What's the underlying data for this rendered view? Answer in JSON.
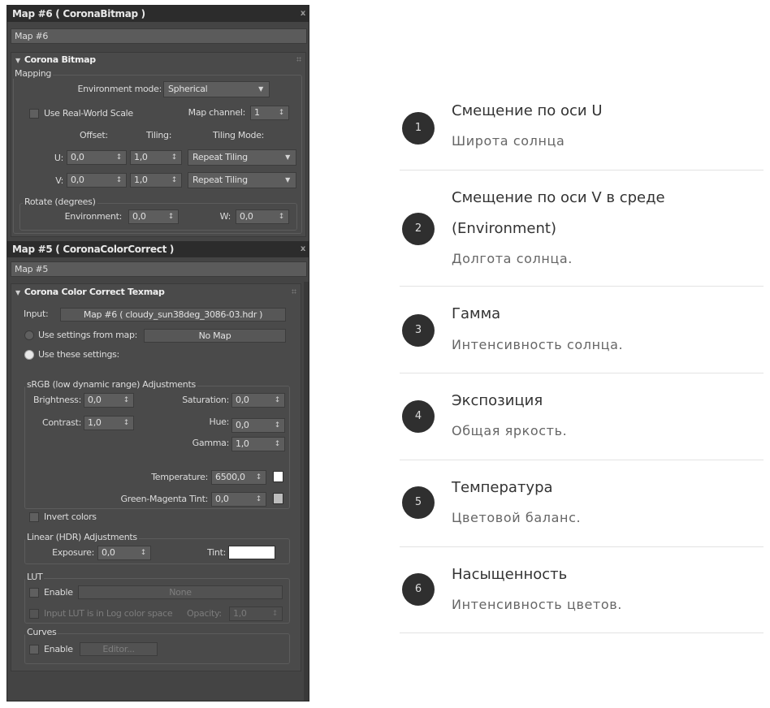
{
  "map6": {
    "title": "Map #6  ( CoronaBitmap )",
    "close": "x",
    "name": "Map #6",
    "rollout_title": "Corona Bitmap",
    "mapping_label": "Mapping",
    "env_mode_label": "Environment mode:",
    "env_mode_value": "Spherical",
    "real_world_scale": "Use Real-World Scale",
    "map_channel_label": "Map channel:",
    "map_channel_value": "1",
    "offset_header": "Offset:",
    "tiling_header": "Tiling:",
    "tiling_mode_header": "Tiling Mode:",
    "u_label": "U:",
    "v_label": "V:",
    "u_offset": "0,0",
    "u_tiling": "1,0",
    "u_mode": "Repeat Tiling",
    "v_offset": "0,0",
    "v_tiling": "1,0",
    "v_mode": "Repeat Tiling",
    "rotate_label": "Rotate (degrees)",
    "environment_label": "Environment:",
    "environment_value": "0,0",
    "w_label": "W:",
    "w_value": "0,0"
  },
  "map5": {
    "title": "Map #5  ( CoronaColorCorrect )",
    "close": "x",
    "name": "Map #5",
    "rollout_title": "Corona Color Correct Texmap",
    "input_label": "Input:",
    "input_value": "Map #6 ( cloudy_sun38deg_3086-03.hdr )",
    "use_settings_from_map": "Use settings from map:",
    "no_map": "No Map",
    "use_these_settings": "Use these settings:",
    "srgb_label": "sRGB (low dynamic range) Adjustments",
    "brightness_label": "Brightness:",
    "brightness_value": "0,0",
    "saturation_label": "Saturation:",
    "saturation_value": "0,0",
    "contrast_label": "Contrast:",
    "contrast_value": "1,0",
    "hue_label": "Hue:",
    "hue_value": "0,0",
    "gamma_label": "Gamma:",
    "gamma_value": "1,0",
    "temperature_label": "Temperature:",
    "temperature_value": "6500,0",
    "tint_gm_label": "Green-Magenta Tint:",
    "tint_gm_value": "0,0",
    "invert_colors": "Invert colors",
    "linear_label": "Linear (HDR) Adjustments",
    "exposure_label": "Exposure:",
    "exposure_value": "0,0",
    "tint_label": "Tint:",
    "lut_label": "LUT",
    "lut_enable": "Enable",
    "lut_none": "None",
    "lut_log": "Input LUT is in Log color space",
    "opacity_label": "Opacity:",
    "opacity_value": "1,0",
    "curves_label": "Curves",
    "curves_enable": "Enable",
    "editor": "Editor..."
  },
  "spinner_arrow": "↕",
  "dropdown_arrow": "▼",
  "rollout_arrow": "▼",
  "list": [
    {
      "num": "1",
      "title": "Смещение по оси U",
      "desc": "Широта солнца"
    },
    {
      "num": "2",
      "title": "Смещение по оси V в среде",
      "title2": "(Environment)",
      "desc": "Долгота солнца."
    },
    {
      "num": "3",
      "title": "Гамма",
      "desc": "Интенсивность солнца."
    },
    {
      "num": "4",
      "title": "Экспозиция",
      "desc": "Общая яркость."
    },
    {
      "num": "5",
      "title": "Температура",
      "desc": "Цветовой баланс."
    },
    {
      "num": "6",
      "title": "Насыщенность",
      "desc": "Интенсивность цветов."
    }
  ],
  "colors": {
    "panel_bg": "#444444",
    "titlebar_bg": "#2c2c2c",
    "circle_bg": "#2f2f2f",
    "temperature_swatch": "#ffffff",
    "tint_swatch": "#bdbdbd",
    "linear_tint_swatch": "#ffffff"
  }
}
